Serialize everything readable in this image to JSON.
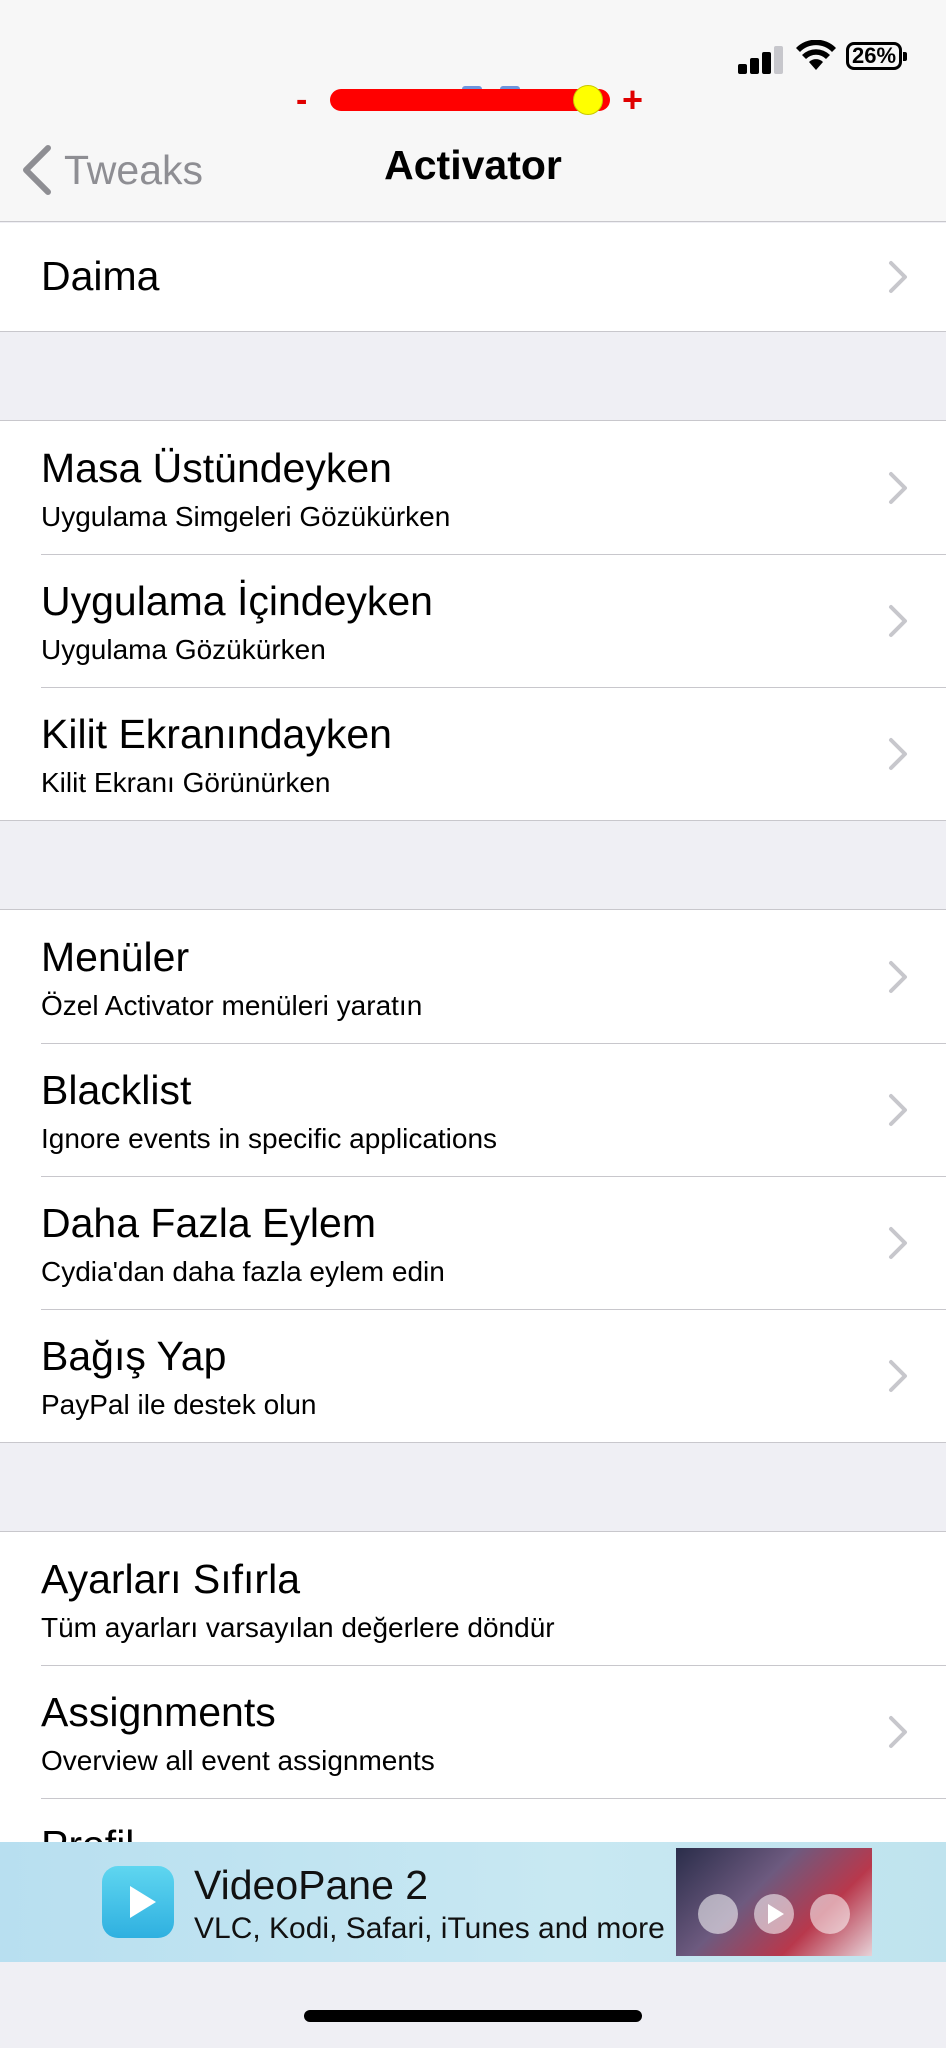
{
  "status_bar": {
    "battery_text": "26%",
    "icons": [
      "cellular-signal-icon",
      "wifi-icon",
      "battery-icon"
    ]
  },
  "brightness_slider": {
    "minus_label": "-",
    "plus_label": "+",
    "level": 0.92,
    "track_color": "#ff0000",
    "knob_color": "#ffff00"
  },
  "nav": {
    "back_label": "Tweaks",
    "title": "Activator"
  },
  "sections": [
    {
      "rows": [
        {
          "title": "Daima",
          "subtitle": "",
          "chevron": true
        }
      ]
    },
    {
      "rows": [
        {
          "title": "Masa Üstündeyken",
          "subtitle": "Uygulama Simgeleri Gözükürken",
          "chevron": true
        },
        {
          "title": "Uygulama İçindeyken",
          "subtitle": "Uygulama Gözükürken",
          "chevron": true
        },
        {
          "title": "Kilit Ekranındayken",
          "subtitle": "Kilit Ekranı Görünürken",
          "chevron": true
        }
      ]
    },
    {
      "rows": [
        {
          "title": "Menüler",
          "subtitle": "Özel Activator menüleri yaratın",
          "chevron": true
        },
        {
          "title": "Blacklist",
          "subtitle": "Ignore events in specific applications",
          "chevron": true
        },
        {
          "title": "Daha Fazla Eylem",
          "subtitle": "Cydia'dan daha fazla eylem edin",
          "chevron": true
        },
        {
          "title": "Bağış Yap",
          "subtitle": "PayPal ile destek olun",
          "chevron": true
        }
      ]
    },
    {
      "rows": [
        {
          "title": "Ayarları Sıfırla",
          "subtitle": "Tüm ayarları varsayılan değerlere döndür",
          "chevron": false
        },
        {
          "title": "Assignments",
          "subtitle": "Overview all event assignments",
          "chevron": true
        },
        {
          "title": "Profil",
          "subtitle": "",
          "chevron": true
        }
      ]
    }
  ],
  "ad": {
    "title": "VideoPane 2",
    "subtitle": "VLC, Kodi, Safari, iTunes and more"
  },
  "colors": {
    "background": "#efeff4",
    "separator": "#c8c7cc",
    "back_label": "#8e8e93",
    "chevron": "#c7c7cc"
  }
}
